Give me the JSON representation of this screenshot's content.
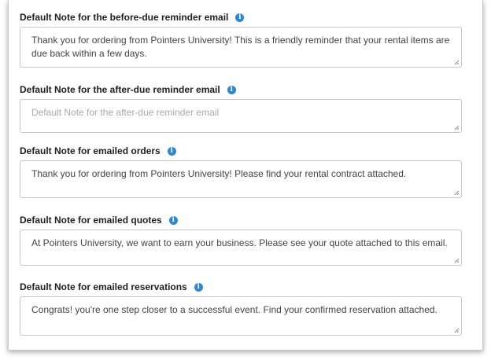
{
  "fields": [
    {
      "label": "Default Note for the before-due reminder email",
      "value": "Thank you for ordering from Pointers University! This is a friendly reminder that your rental items are due back within a few days.",
      "placeholder": ""
    },
    {
      "label": "Default Note for the after-due reminder email",
      "value": "",
      "placeholder": "Default Note for the after-due reminder email"
    },
    {
      "label": "Default Note for emailed orders",
      "value": "Thank you for ordering from Pointers University!  Please find your rental contract attached.",
      "placeholder": ""
    },
    {
      "label": "Default Note for emailed quotes",
      "value": "At Pointers University, we want to earn your business. Please see your quote attached to this email.",
      "placeholder": ""
    },
    {
      "label": "Default Note for emailed reservations",
      "value": "Congrats! you're one step closer to a successful event.  Find your confirmed reservation attached.",
      "placeholder": ""
    }
  ],
  "info_icon_glyph": "i",
  "colors": {
    "info_icon": "#2a86d8"
  }
}
